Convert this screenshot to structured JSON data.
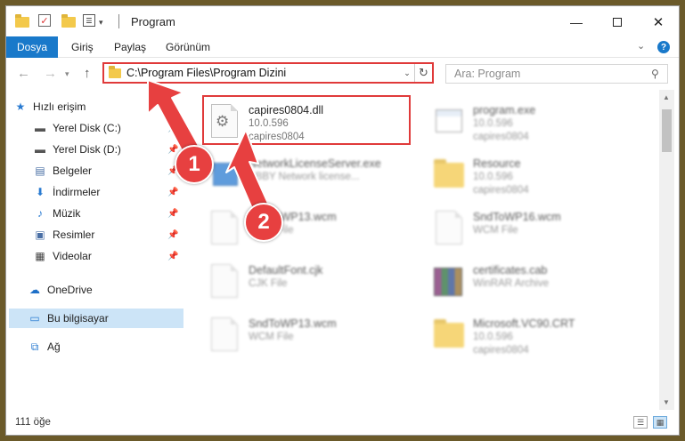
{
  "titlebar": {
    "title": "Program",
    "minimize_icon": "minimize-icon",
    "maximize_icon": "maximize-icon",
    "close_icon": "close-icon",
    "min_glyph": "—",
    "close_glyph": "✕"
  },
  "ribbon": {
    "file_tab": "Dosya",
    "tabs": [
      "Giriş",
      "Paylaş",
      "Görünüm"
    ],
    "help_glyph": "?"
  },
  "navigation": {
    "address": "C:\\Program Files\\Program Dizini",
    "search_placeholder": "Ara: Program"
  },
  "sidebar": {
    "items": [
      {
        "label": "Hızlı erişim",
        "icon": "star-icon",
        "pinned": false
      },
      {
        "label": "Yerel Disk (C:)",
        "icon": "drive-icon",
        "pinned": true
      },
      {
        "label": "Yerel Disk (D:)",
        "icon": "drive-icon",
        "pinned": true
      },
      {
        "label": "Belgeler",
        "icon": "documents-icon",
        "pinned": true
      },
      {
        "label": "İndirmeler",
        "icon": "download-icon",
        "pinned": true
      },
      {
        "label": "Müzik",
        "icon": "music-icon",
        "pinned": true
      },
      {
        "label": "Resimler",
        "icon": "pictures-icon",
        "pinned": true
      },
      {
        "label": "Videolar",
        "icon": "videos-icon",
        "pinned": true
      },
      {
        "label": "OneDrive",
        "icon": "cloud-icon",
        "pinned": false
      },
      {
        "label": "Bu bilgisayar",
        "icon": "computer-icon",
        "pinned": false
      },
      {
        "label": "Ağ",
        "icon": "network-icon",
        "pinned": false
      }
    ]
  },
  "files": [
    {
      "name": "capires0804.dll",
      "line2": "10.0.596",
      "line3": "capires0804",
      "icon": "dll-gear-icon",
      "highlighted": true
    },
    {
      "name": "program.exe",
      "line2": "10.0.596",
      "line3": "capires0804",
      "icon": "exe-icon",
      "highlighted": false
    },
    {
      "name": "NetworkLicenseServer.exe",
      "line2": "BBBY Network license...",
      "line3": "",
      "icon": "app-icon",
      "highlighted": false
    },
    {
      "name": "Resource",
      "line2": "10.0.596",
      "line3": "capires0804",
      "icon": "folder-icon",
      "highlighted": false
    },
    {
      "name": "SndToWP13.wcm",
      "line2": "WCM File",
      "line3": "",
      "icon": "file-icon",
      "highlighted": false
    },
    {
      "name": "SndToWP16.wcm",
      "line2": "WCM File",
      "line3": "",
      "icon": "file-icon",
      "highlighted": false
    },
    {
      "name": "DefaultFont.cjk",
      "line2": "CJK File",
      "line3": "",
      "icon": "file-icon",
      "highlighted": false
    },
    {
      "name": "certificates.cab",
      "line2": "WinRAR Archive",
      "line3": "",
      "icon": "archive-icon",
      "highlighted": false
    },
    {
      "name": "SndToWP13.wcm",
      "line2": "WCM File",
      "line3": "",
      "icon": "file-icon",
      "highlighted": false
    },
    {
      "name": "Microsoft.VC90.CRT",
      "line2": "10.0.596",
      "line3": "capires0804",
      "icon": "folder-doc-icon",
      "highlighted": false
    }
  ],
  "status": {
    "item_count": "111 öğe"
  },
  "annotations": {
    "badge_1": "1",
    "badge_2": "2",
    "accent_color": "#e03a3a"
  }
}
